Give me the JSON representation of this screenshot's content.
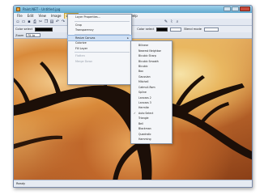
{
  "window": {
    "title": "Paint.NET - Untitled.jpg"
  },
  "menubar": {
    "items": [
      "File",
      "Edit",
      "View",
      "Image",
      "Layers",
      "Adjust",
      "Effects",
      "Window",
      "Help"
    ],
    "active_index": 4
  },
  "toolbar2": {
    "primary_label": "Color select",
    "secondary_label": "Color select",
    "blend_label": "Blend mode"
  },
  "toolbar3": {
    "zoom_label": "Zoom",
    "zoom_value": "Fit to"
  },
  "image_menu": {
    "items": [
      {
        "label": "Layer Properties...",
        "disabled": false,
        "highlight": false
      },
      {
        "label": "Crop",
        "disabled": false,
        "highlight": false
      },
      {
        "label": "Transparency",
        "disabled": false,
        "highlight": false
      },
      {
        "label": "Resize Canvas",
        "disabled": false,
        "highlight": true,
        "has_submenu": true
      },
      {
        "label": "Colorize",
        "disabled": false,
        "highlight": false
      },
      {
        "label": "Fill Layer",
        "disabled": false,
        "highlight": false
      },
      {
        "label": "Flatten",
        "disabled": true,
        "highlight": false
      },
      {
        "label": "Merge Down",
        "disabled": true,
        "highlight": false
      }
    ]
  },
  "submenu": {
    "items": [
      {
        "label": "Bilinear",
        "checked": false
      },
      {
        "label": "Nearest Neighbor",
        "checked": false
      },
      {
        "label": "Bicubic Sharp",
        "checked": false
      },
      {
        "label": "Bicubic Smooth",
        "checked": false
      },
      {
        "label": "Bicubic",
        "checked": false
      },
      {
        "label": "Box",
        "checked": false
      },
      {
        "label": "Gaussian",
        "checked": false
      },
      {
        "label": "Mitchell",
        "checked": false
      },
      {
        "label": "Catmull-Rom",
        "checked": false
      },
      {
        "label": "Spline",
        "checked": false
      },
      {
        "label": "Lanczos 2",
        "checked": false
      },
      {
        "label": "Lanczos 3",
        "checked": false
      },
      {
        "label": "Hermite",
        "checked": false
      },
      {
        "label": "Auto Select",
        "checked": true
      },
      {
        "label": "Triangle",
        "checked": false
      },
      {
        "label": "Bell",
        "checked": false
      },
      {
        "label": "Blackman",
        "checked": false
      },
      {
        "label": "Quadratic",
        "checked": false
      },
      {
        "label": "Hamming",
        "checked": false
      }
    ]
  },
  "status": {
    "text": "Ready"
  },
  "icons": {
    "toolbar": [
      "new-icon",
      "open-icon",
      "save-icon",
      "print-icon",
      "cut-icon",
      "copy-icon",
      "paste-icon",
      "undo-icon",
      "redo-icon"
    ]
  }
}
